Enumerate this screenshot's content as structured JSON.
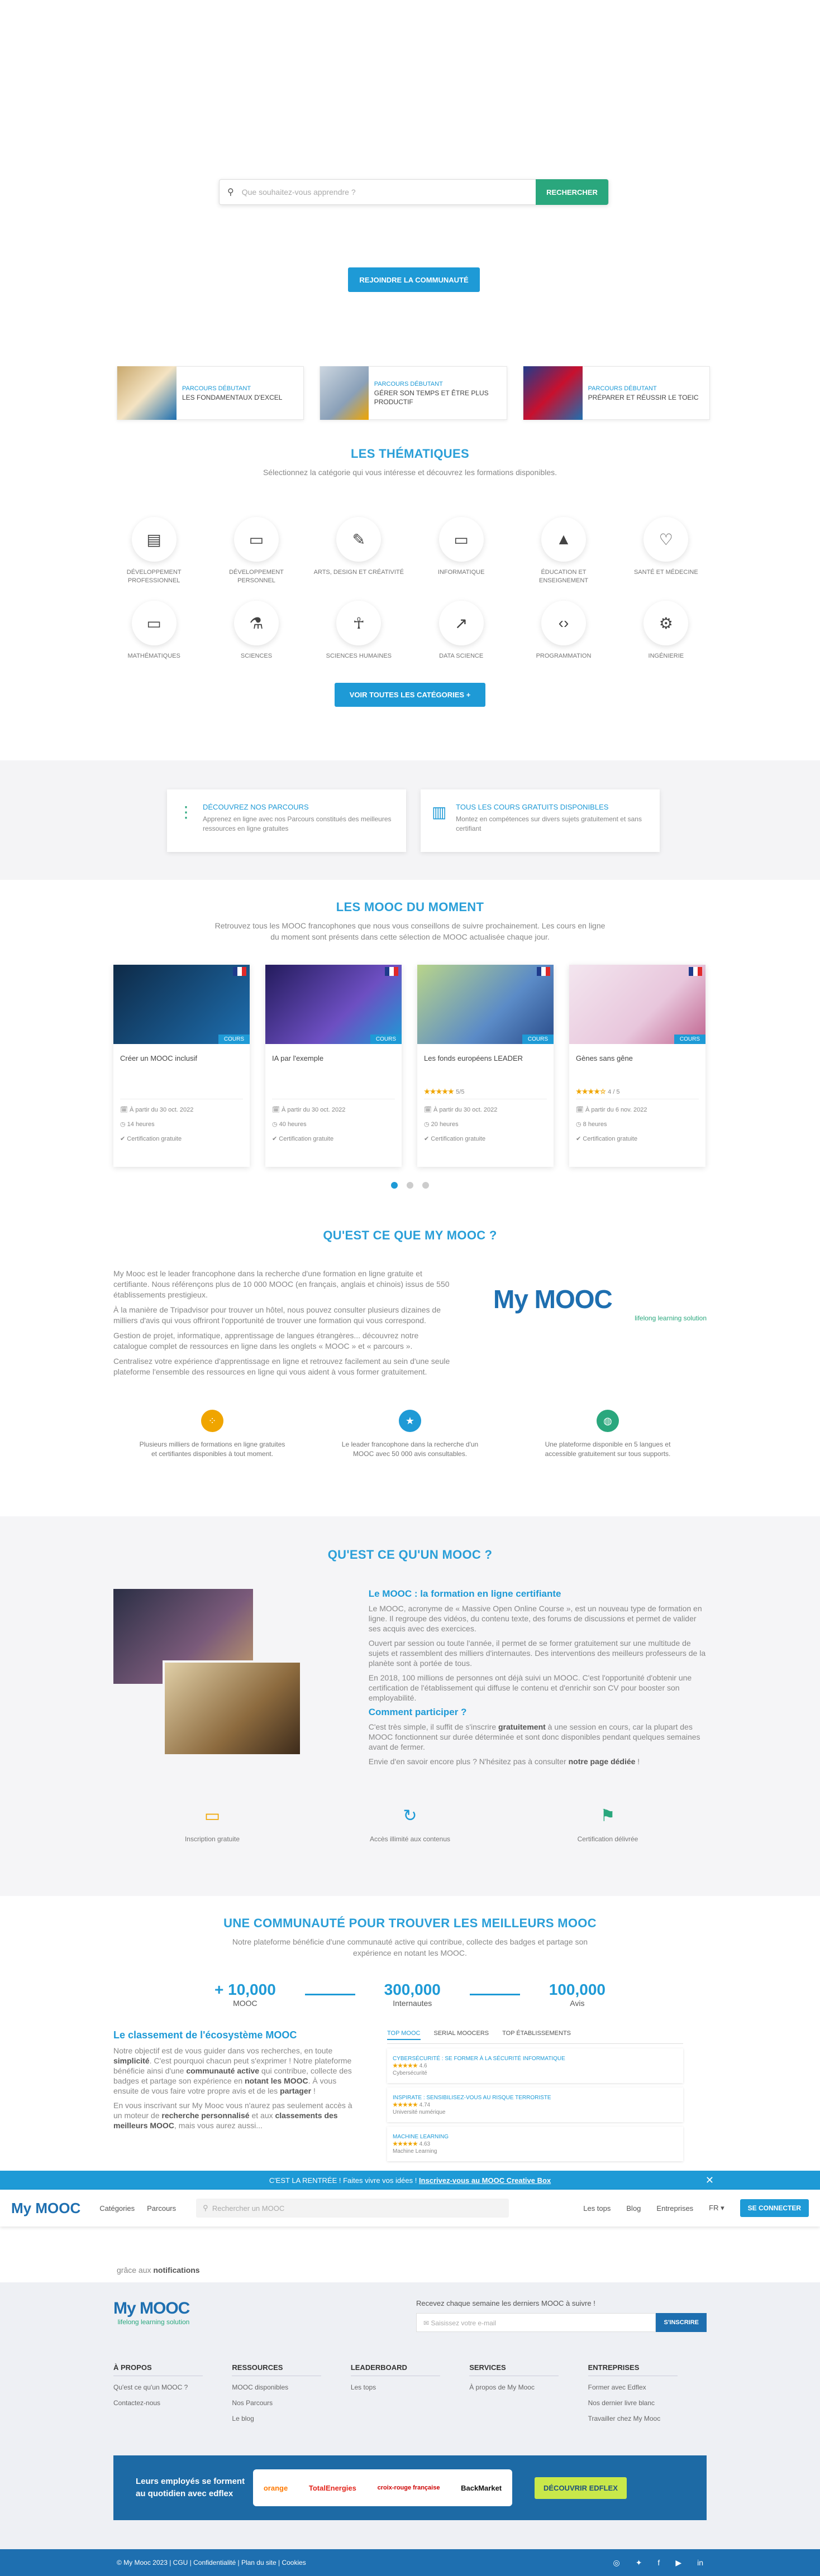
{
  "hero": {
    "search_placeholder": "Que souhaitez-vous apprendre ?",
    "search_button": "RECHERCHER",
    "join_button": "REJOINDRE LA COMMUNAUTÉ"
  },
  "parcours": [
    {
      "kicker": "PARCOURS DÉBUTANT",
      "name": "LES FONDAMENTAUX D'EXCEL"
    },
    {
      "kicker": "PARCOURS DÉBUTANT",
      "name": "GÉRER SON TEMPS ET ÊTRE PLUS PRODUCTIF"
    },
    {
      "kicker": "PARCOURS DÉBUTANT",
      "name": "PRÉPARER ET RÉUSSIR LE TOEIC"
    }
  ],
  "thematiques": {
    "title": "LES THÉMATIQUES",
    "subtitle": "Sélectionnez la catégorie qui vous intéresse et découvrez les formations disponibles.",
    "button": "VOIR TOUTES LES CATÉGORIES +",
    "items": [
      "DÉVELOPPEMENT PROFESSIONNEL",
      "DÉVELOPPEMENT PERSONNEL",
      "ARTS, DESIGN ET CRÉATIVITÉ",
      "INFORMATIQUE",
      "ÉDUCATION ET ENSEIGNEMENT",
      "SANTÉ ET MÉDECINE",
      "MATHÉMATIQUES",
      "SCIENCES",
      "SCIENCES HUMAINES",
      "DATA SCIENCE",
      "PROGRAMMATION",
      "INGÉNIERIE"
    ]
  },
  "discover": [
    {
      "title": "DÉCOUVREZ NOS PARCOURS",
      "desc": "Apprenez en ligne avec nos Parcours constitués des meilleures ressources en ligne gratuites"
    },
    {
      "title": "TOUS LES COURS GRATUITS DISPONIBLES",
      "desc": "Montez en compétences sur divers sujets gratuitement et sans certifiant"
    }
  ],
  "mdm": {
    "title": "LES MOOC DU MOMENT",
    "subtitle": "Retrouvez tous les MOOC francophones que nous vous conseillons de suivre prochainement. Les cours en ligne du moment sont présents dans cette sélection de MOOC actualisée chaque jour.",
    "courses": [
      {
        "title": "Créer un MOOC inclusif",
        "badge": "COURS",
        "stars": "",
        "rating": "",
        "date": "À partir du 30 oct. 2022",
        "hours": "14 heures",
        "cert": "Certification gratuite"
      },
      {
        "title": "IA par l'exemple",
        "badge": "COURS",
        "stars": "",
        "rating": "",
        "date": "À partir du 30 oct. 2022",
        "hours": "40 heures",
        "cert": "Certification gratuite"
      },
      {
        "title": "Les fonds européens LEADER",
        "badge": "COURS",
        "stars": "★★★★★",
        "rating": "5/5",
        "date": "À partir du 30 oct. 2022",
        "hours": "20 heures",
        "cert": "Certification gratuite"
      },
      {
        "title": "Gènes sans gêne",
        "badge": "COURS",
        "stars": "★★★★☆",
        "rating": "4 / 5",
        "date": "À partir du 6 nov. 2022",
        "hours": "8 heures",
        "cert": "Certification gratuite"
      }
    ]
  },
  "qmm": {
    "title": "QU'EST CE QUE MY MOOC ?",
    "p1": "My Mooc est le leader francophone dans la recherche d'une formation en ligne gratuite et certifiante. Nous référençons plus de 10 000 MOOC (en français, anglais et chinois) issus de 550 établissements prestigieux.",
    "p2": "À la manière de Tripadvisor pour trouver un hôtel, nous pouvez consulter plusieurs dizaines de milliers d'avis qui vous offriront l'opportunité de trouver une formation qui vous correspond.",
    "p3": "Gestion de projet, informatique, apprentissage de langues étrangères... découvrez notre catalogue complet de ressources en ligne dans les onglets « MOOC » et « parcours ».",
    "p4": "Centralisez votre expérience d'apprentissage en ligne et retrouvez facilement au sein d'une seule plateforme l'ensemble des ressources en ligne qui vous aident à vous former gratuitement.",
    "logo": "My MOOC",
    "tagline": "lifelong learning solution",
    "features": [
      "Plusieurs milliers de formations en ligne gratuites et certifiantes disponibles à tout moment.",
      "Le leader francophone dans la recherche d'un MOOC avec 50 000 avis consultables.",
      "Une plateforme disponible en 5 langues et accessible gratuitement sur tous supports."
    ]
  },
  "qum": {
    "title": "QU'EST CE QU'UN MOOC ?",
    "h1": "Le MOOC : la formation en ligne certifiante",
    "p1": "Le MOOC, acronyme de « Massive Open Online Course », est un nouveau type de formation en ligne. Il regroupe des vidéos, du contenu texte, des forums de discussions et permet de valider ses acquis avec des exercices.",
    "p2": "Ouvert par session ou toute l'année, il permet de se former gratuitement sur une multitude de sujets et rassemblent des milliers d'internautes. Des interventions des meilleurs professeurs de la planète sont à portée de tous.",
    "p3": "En 2018, 100 millions de personnes ont déjà suivi un MOOC. C'est l'opportunité d'obtenir une certification de l'établissement qui diffuse le contenu et d'enrichir son CV pour booster son employabilité.",
    "h2": "Comment participer ?",
    "p4a": "C'est très simple, il suffit de s'inscrire ",
    "p4b": "gratuitement",
    "p4c": " à une session en cours, car la plupart des MOOC fonctionnent sur durée déterminée et sont donc disponibles pendant quelques semaines avant de fermer.",
    "p5a": "Envie d'en savoir encore plus ? N'hésitez pas à consulter ",
    "p5b": "notre page dédiée",
    "p5c": " !",
    "features": [
      "Inscription gratuite",
      "Accès illimité aux contenus",
      "Certification délivrée"
    ]
  },
  "comm": {
    "title": "UNE COMMUNAUTÉ POUR TROUVER LES MEILLEURS MOOC",
    "subtitle": "Notre plateforme bénéficie d'une communauté active qui contribue, collecte des badges et partage son expérience en notant les MOOC.",
    "stats": [
      {
        "n": "+ 10,000",
        "l": "MOOC"
      },
      {
        "n": "300,000",
        "l": "Internautes"
      },
      {
        "n": "100,000",
        "l": "Avis"
      }
    ],
    "h3": "Le classement de l'écosystème MOOC",
    "p1a": "Notre objectif est de vous guider dans vos recherches, en toute ",
    "p1b": "simplicité",
    "p1c": ". C'est pourquoi chacun peut s'exprimer ! Notre plateforme bénéficie ainsi d'une ",
    "p1d": "communauté active",
    "p1e": " qui contribue, collecte des badges et partage son expérience en ",
    "p1f": "notant les MOOC",
    "p1g": ". À vous ensuite de vous faire votre propre avis et de les ",
    "p1h": "partager",
    "p1i": " !",
    "p2a": "En vous inscrivant sur My Mooc vous n'aurez pas seulement accès à un moteur de ",
    "p2b": "recherche personnalisé",
    "p2c": " et aux ",
    "p2d": "classements des meilleurs MOOC",
    "p2e": ", mais vous aurez aussi...",
    "tail_a": "grâce aux ",
    "tail_b": "notifications",
    "tabs": [
      "TOP MOOC",
      "SERIAL MOOCERS",
      "TOP ÉTABLISSEMENTS"
    ],
    "tops": [
      {
        "title": "CYBERSÉCURITÉ : SE FORMER À LA SÉCURITÉ INFORMATIQUE",
        "stars": "★★★★★",
        "rating": "4.6",
        "org": "Cybersécurité"
      },
      {
        "title": "INSPIRATE : SENSIBILISEZ-VOUS AU RISQUE TERRORISTE",
        "stars": "★★★★★",
        "rating": "4.74",
        "org": "Université numérique"
      },
      {
        "title": "MACHINE LEARNING",
        "stars": "★★★★★",
        "rating": "4.63",
        "org": "Machine Learning"
      }
    ]
  },
  "promo": {
    "a": "C'EST LA RENTRÉE ! Faites vivre vos idées ! ",
    "b": "Inscrivez-vous au MOOC Creative Box"
  },
  "nav": {
    "logo": "My MOOC",
    "menu": [
      "Catégories",
      "Parcours"
    ],
    "search": "Rechercher un MOOC",
    "links": [
      "Les tops",
      "Blog",
      "Entreprises"
    ],
    "lang": "FR",
    "connect": "SE CONNECTER"
  },
  "footer": {
    "logo": "My MOOC",
    "tagline": "lifelong learning solution",
    "nl_title": "Recevez chaque semaine les derniers MOOC à suivre !",
    "nl_placeholder": "Saisissez votre e-mail",
    "nl_button": "S'INSCRIRE",
    "cols": [
      {
        "h": "À PROPOS",
        "items": [
          "Qu'est ce qu'un MOOC ?",
          "Contactez-nous"
        ]
      },
      {
        "h": "RESSOURCES",
        "items": [
          "MOOC disponibles",
          "Nos Parcours",
          "Le blog"
        ]
      },
      {
        "h": "LEADERBOARD",
        "items": [
          "Les tops"
        ]
      },
      {
        "h": "SERVICES",
        "items": [
          "À propos de My Mooc"
        ]
      },
      {
        "h": "ENTREPRISES",
        "items": [
          "Former avec Edflex",
          "Nos dernier livre blanc",
          "Travailler chez My Mooc"
        ]
      }
    ],
    "edf_text": "Leurs employés se forment au quotidien avec edflex",
    "edf_logos": [
      "orange",
      "TotalEnergies",
      "croix-rouge française",
      "BackMarket"
    ],
    "edf_cta": "DÉCOUVRIR EDFLEX",
    "bottom": "© My Mooc 2023 | CGU | Confidentialité | Plan du site | Cookies"
  },
  "colors": {
    "accent": "#1e9ad6",
    "green": "#2aa77d",
    "navy": "#1e6fb0",
    "star": "#f0a500"
  }
}
